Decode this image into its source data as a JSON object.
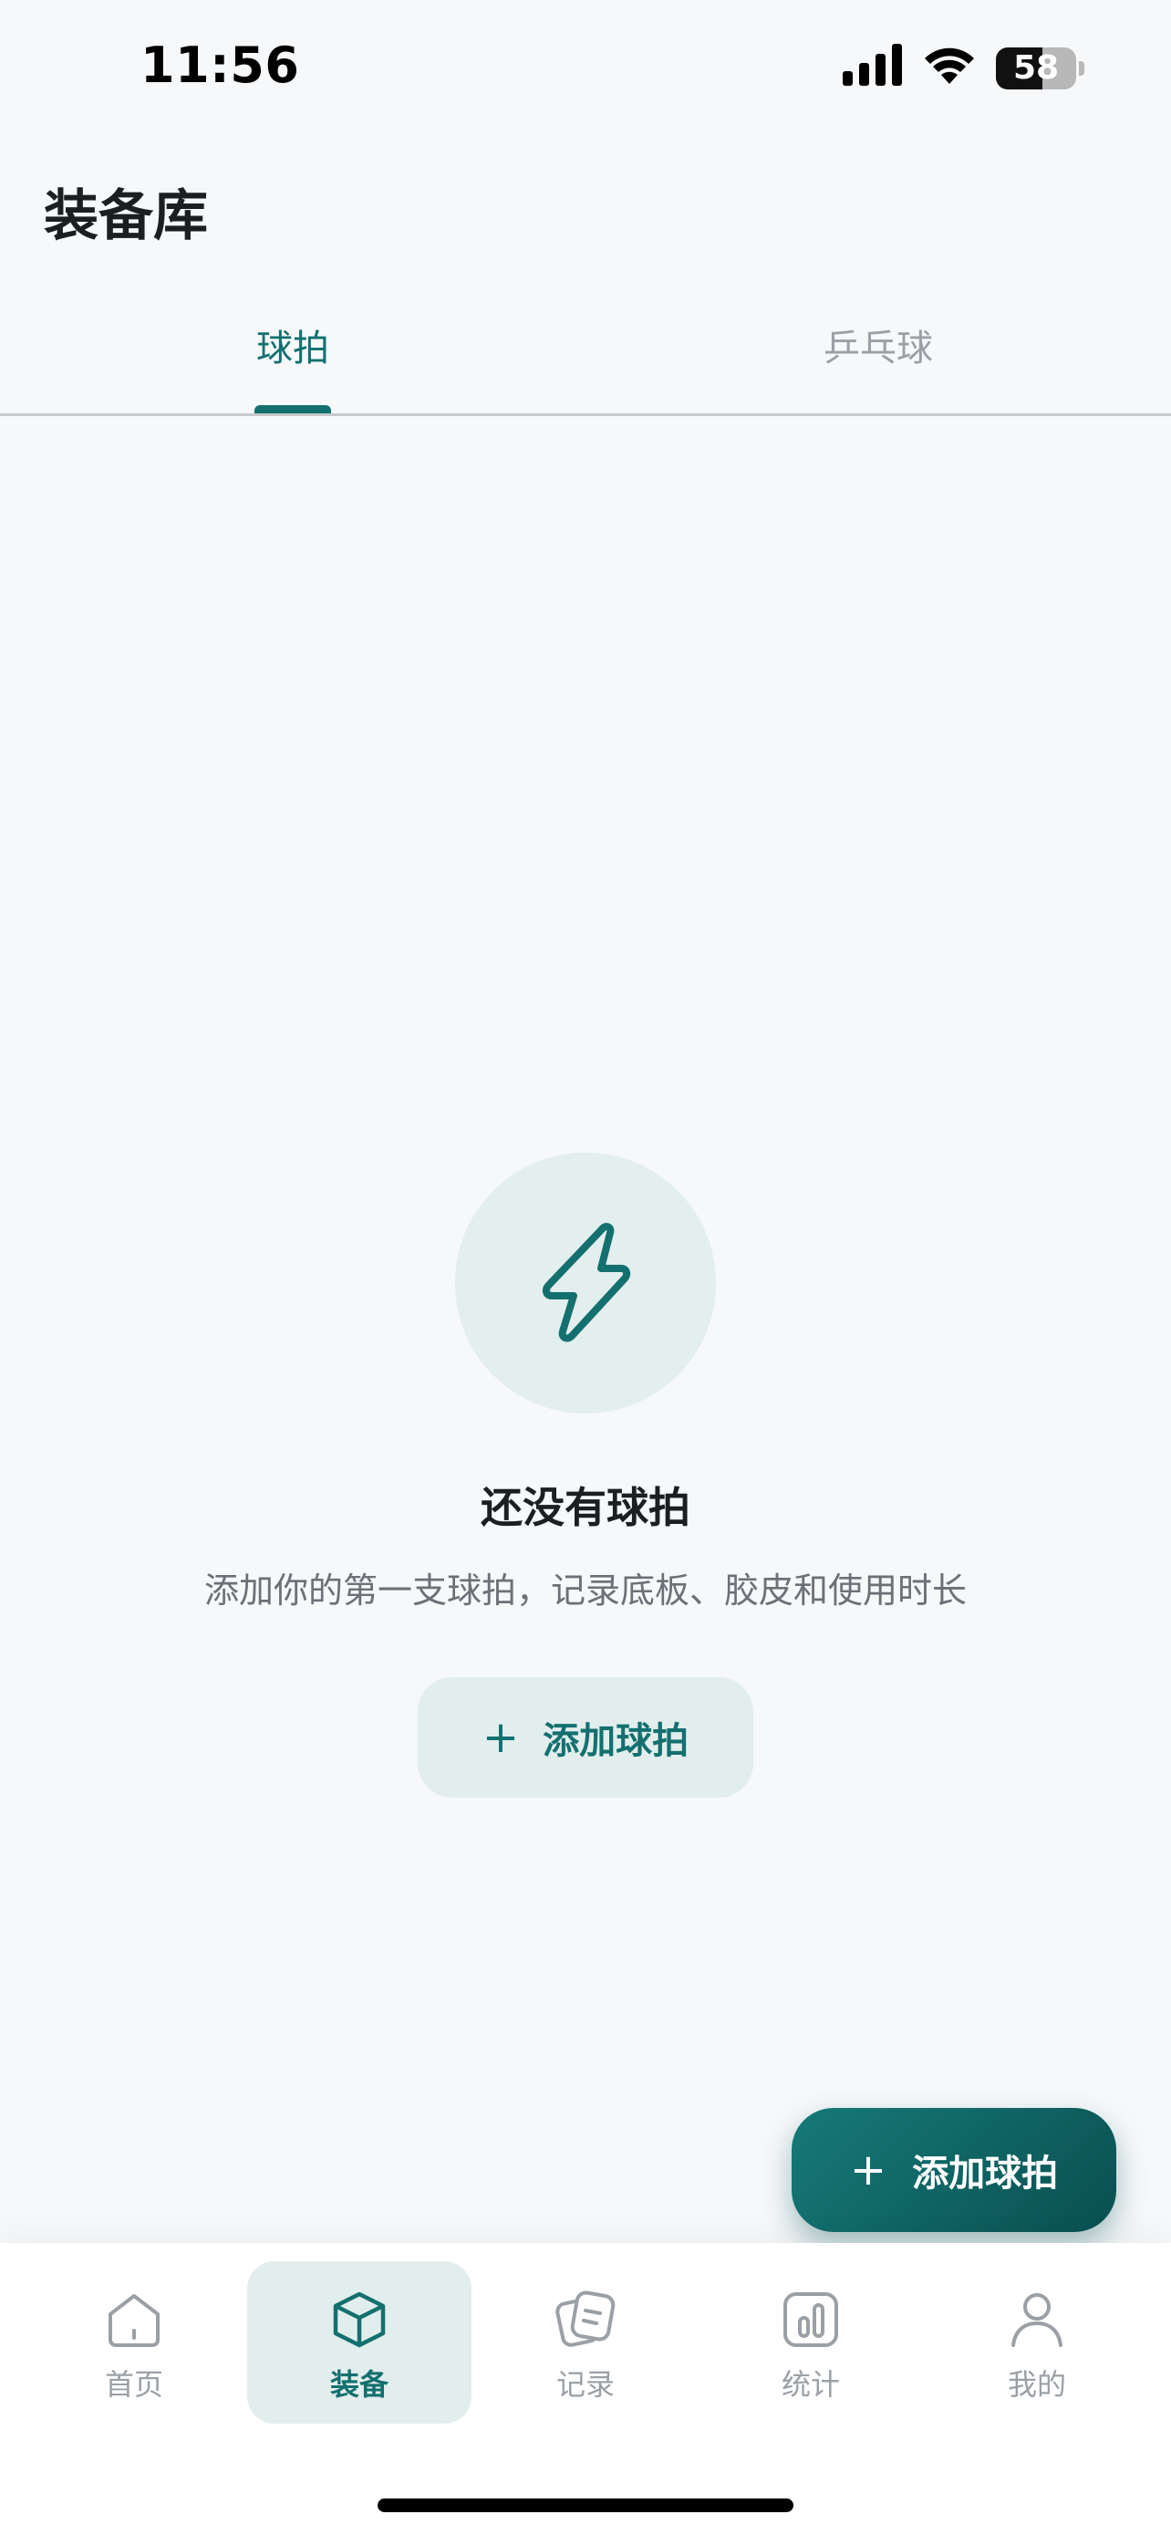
{
  "status_bar": {
    "time": "11:56",
    "battery_level": "58",
    "battery_fraction": 0.58
  },
  "header": {
    "title": "装备库"
  },
  "tabs": [
    {
      "label": "球拍",
      "active": true
    },
    {
      "label": "乒乓球",
      "active": false
    }
  ],
  "empty_state": {
    "icon": "lightning-icon",
    "title": "还没有球拍",
    "description": "添加你的第一支球拍，记录底板、胶皮和使用时长",
    "button_plus": "+",
    "button_label": "添加球拍"
  },
  "fab": {
    "plus": "+",
    "label": "添加球拍"
  },
  "bottom_nav": {
    "items": [
      {
        "label": "首页",
        "icon": "home-icon",
        "active": false
      },
      {
        "label": "装备",
        "icon": "box-icon",
        "active": true
      },
      {
        "label": "记录",
        "icon": "notes-icon",
        "active": false
      },
      {
        "label": "统计",
        "icon": "chart-icon",
        "active": false
      },
      {
        "label": "我的",
        "icon": "user-icon",
        "active": false
      }
    ]
  },
  "colors": {
    "accent": "#13706f",
    "accent_light": "#e2eded",
    "background": "#f6f8fa",
    "muted_text": "#9aa0a6"
  }
}
